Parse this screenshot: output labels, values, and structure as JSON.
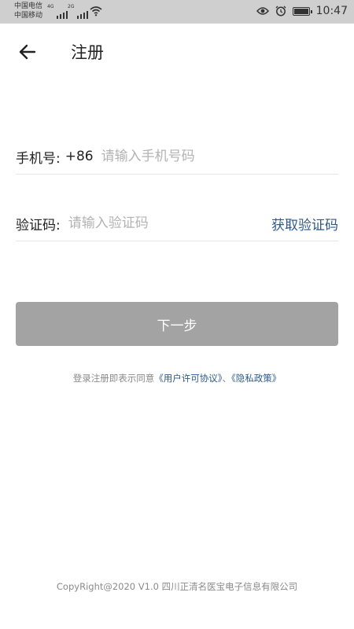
{
  "status_bar": {
    "carrier_1": "中国电信",
    "carrier_2": "中国移动",
    "net_1": "4G",
    "net_2": "2G",
    "time": "10:47",
    "icons": [
      "eye-icon",
      "alarm-icon",
      "battery-icon",
      "wifi-icon",
      "signal-icon"
    ]
  },
  "header": {
    "title": "注册",
    "back_icon": "arrow-left-icon"
  },
  "form": {
    "phone_label": "手机号:",
    "phone_prefix": "+86",
    "phone_placeholder": "请输入手机号码",
    "phone_value": "",
    "code_label": "验证码:",
    "code_placeholder": "请输入验证码",
    "code_value": "",
    "get_code": "获取验证码"
  },
  "next_button": "下一步",
  "agreement": {
    "prefix": "登录注册即表示同意",
    "user_agreement": "《用户许可协议》",
    "separator": "、",
    "privacy_policy": "《隐私政策》"
  },
  "footer": "CopyRight@2020 V1.0 四川正清名医宝电子信息有限公司",
  "colors": {
    "link": "#2d5a8a",
    "button_disabled": "#a3a3a3",
    "statusbar": "#cfcfcf"
  }
}
